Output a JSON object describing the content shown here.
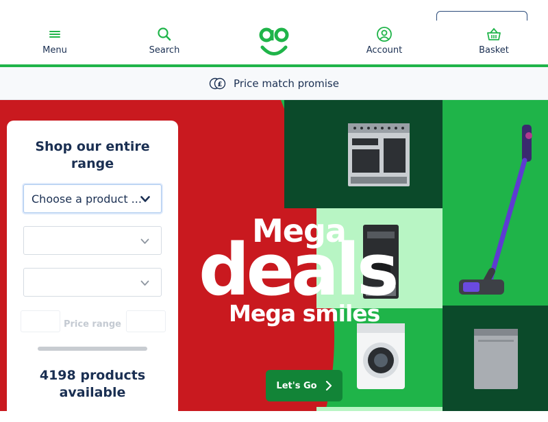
{
  "header": {
    "menu_label": "Menu",
    "search_label": "Search",
    "account_label": "Account",
    "basket_label": "Basket",
    "logo_alt": "ao"
  },
  "promise_bar": {
    "text": "Price match promise",
    "icon": "pound-coin-icon"
  },
  "hero": {
    "headline_top": "Mega",
    "headline_main": "deals",
    "headline_bottom": "Mega smiles",
    "cta_label": "Let's Go",
    "colors": {
      "red": "#c9191f",
      "dark_green": "#0b4a2a",
      "mid_green": "#1fb449",
      "light_green": "#b8f5c4",
      "cta": "#128437"
    }
  },
  "product_finder": {
    "title": "Shop our entire range",
    "category_select_value": "Choose a product ...",
    "select_2_value": "",
    "select_3_value": "",
    "price_range_label": "Price range",
    "products_count_text": "4198 products available"
  },
  "colors": {
    "navy": "#1a2f52",
    "brand_green": "#1fb449"
  }
}
